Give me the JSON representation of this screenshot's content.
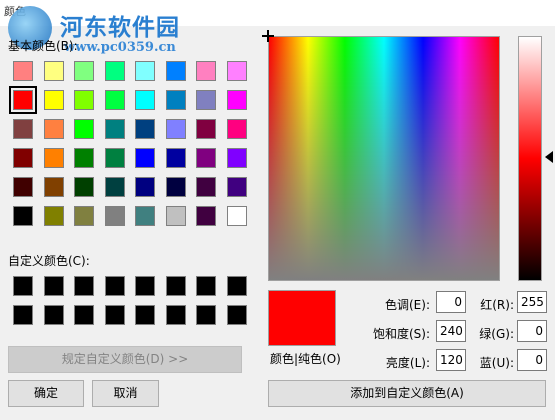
{
  "dialog": {
    "title": "颜色"
  },
  "watermark": {
    "title": "河东软件园",
    "url": "www.pc0359.cn"
  },
  "basic_colors": {
    "label": "基本颜色(B):",
    "rows": [
      [
        "#ff8080",
        "#ffff80",
        "#80ff80",
        "#00ff80",
        "#80ffff",
        "#0080ff",
        "#ff80c0",
        "#ff80ff"
      ],
      [
        "#ff0000",
        "#ffff00",
        "#80ff00",
        "#00ff40",
        "#00ffff",
        "#0080c0",
        "#8080c0",
        "#ff00ff"
      ],
      [
        "#804040",
        "#ff8040",
        "#00ff00",
        "#008080",
        "#004080",
        "#8080ff",
        "#800040",
        "#ff0080"
      ],
      [
        "#800000",
        "#ff8000",
        "#008000",
        "#008040",
        "#0000ff",
        "#0000a0",
        "#800080",
        "#8000ff"
      ],
      [
        "#400000",
        "#804000",
        "#004000",
        "#004040",
        "#000080",
        "#000040",
        "#400040",
        "#400080"
      ],
      [
        "#000000",
        "#808000",
        "#808040",
        "#808080",
        "#408080",
        "#c0c0c0",
        "#400040",
        "#ffffff"
      ]
    ],
    "selected": [
      1,
      0
    ]
  },
  "custom_colors": {
    "label": "自定义颜色(C):",
    "rows": [
      [
        "#000000",
        "#000000",
        "#000000",
        "#000000",
        "#000000",
        "#000000",
        "#000000",
        "#000000"
      ],
      [
        "#000000",
        "#000000",
        "#000000",
        "#000000",
        "#000000",
        "#000000",
        "#000000",
        "#000000"
      ]
    ]
  },
  "buttons": {
    "define_custom": "规定自定义颜色(D) >>",
    "ok": "确定",
    "cancel": "取消",
    "add_custom": "添加到自定义颜色(A)"
  },
  "preview": {
    "label": "颜色|纯色(O)",
    "color": "#ff0000"
  },
  "hsl": {
    "hue_label": "色调(E):",
    "hue": "0",
    "sat_label": "饱和度(S):",
    "sat": "240",
    "lum_label": "亮度(L):",
    "lum": "120"
  },
  "rgb": {
    "red_label": "红(R):",
    "red": "255",
    "green_label": "绿(G):",
    "green": "0",
    "blue_label": "蓝(U):",
    "blue": "0"
  }
}
